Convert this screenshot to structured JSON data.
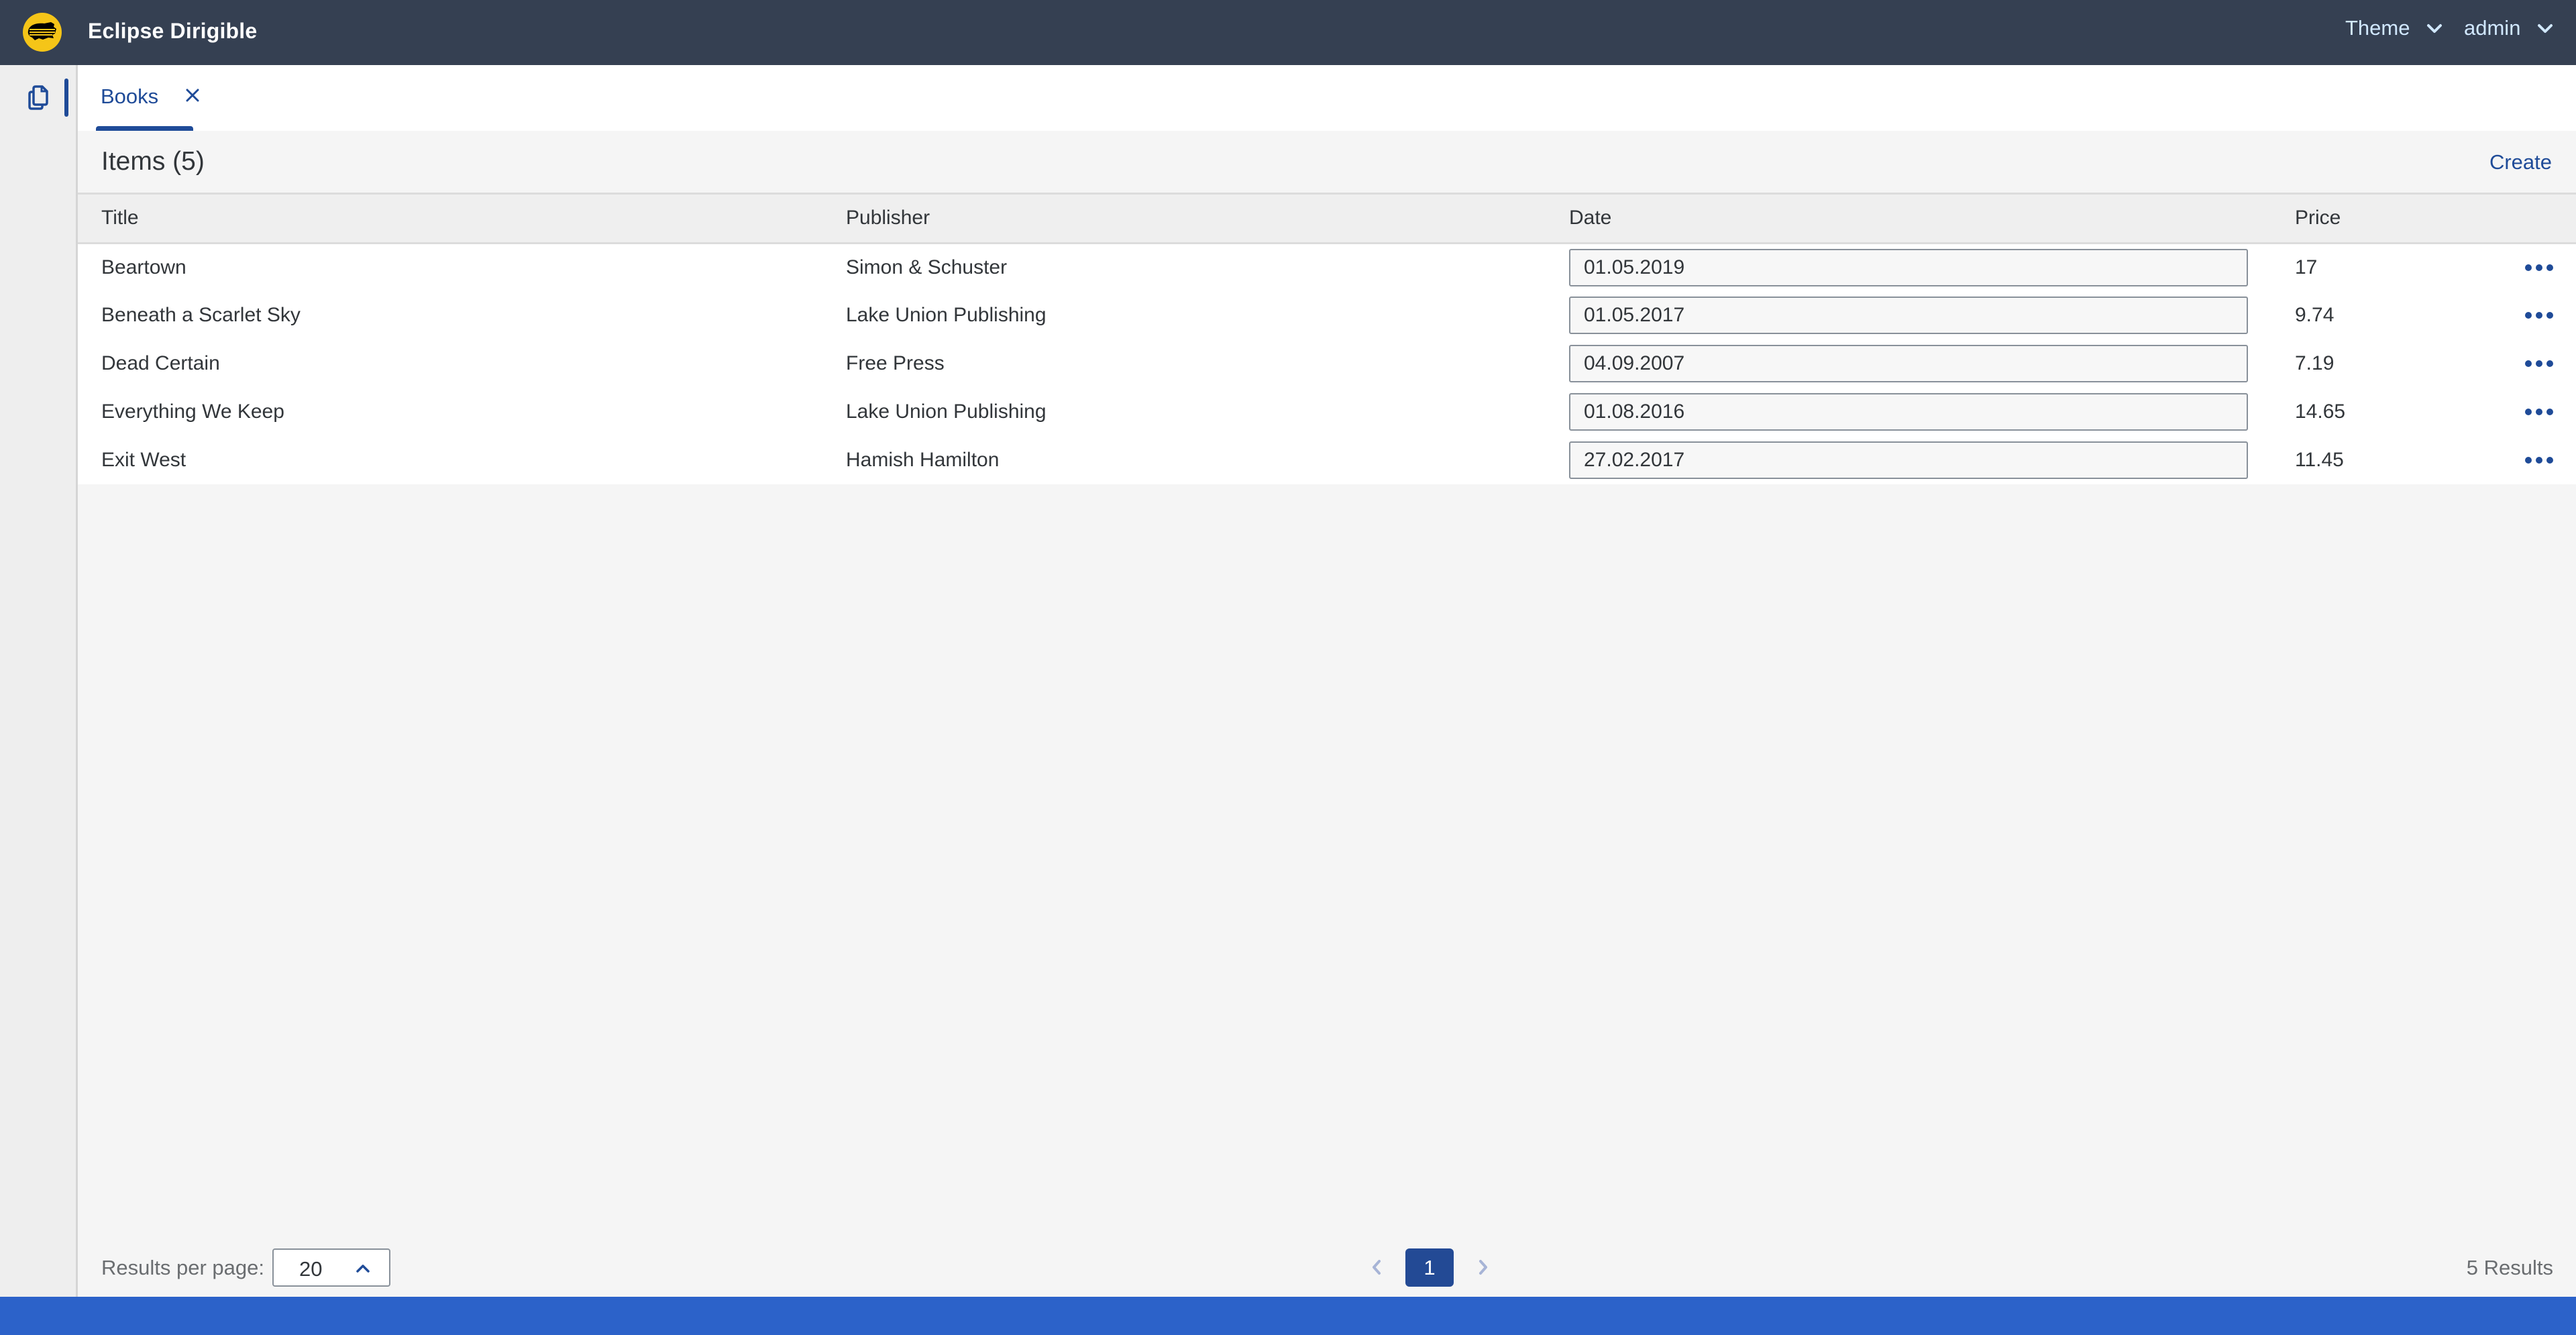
{
  "shell": {
    "product_name": "Eclipse Dirigible",
    "logo_icon": "dirigible-logo-icon",
    "theme_menu_label": "Theme",
    "user_menu_label": "admin",
    "colors": {
      "shell_bg": "#354052",
      "accent": "#1f4b98",
      "status_bar": "#2c62c9",
      "logo_yellow": "#f5c518"
    }
  },
  "sidebar": {
    "items": [
      {
        "icon": "copy-documents-icon",
        "active": true
      }
    ]
  },
  "tabs": [
    {
      "label": "Books",
      "active": true,
      "closable": true
    }
  ],
  "toolbar": {
    "title": "Items (5)",
    "create_label": "Create"
  },
  "table": {
    "columns": [
      "Title",
      "Publisher",
      "Date",
      "Price"
    ],
    "rows": [
      {
        "title": "Beartown",
        "publisher": "Simon & Schuster",
        "date": "01.05.2019",
        "price": "17"
      },
      {
        "title": "Beneath a Scarlet Sky",
        "publisher": "Lake Union Publishing",
        "date": "01.05.2017",
        "price": "9.74"
      },
      {
        "title": "Dead Certain",
        "publisher": "Free Press",
        "date": "04.09.2007",
        "price": "7.19"
      },
      {
        "title": "Everything We Keep",
        "publisher": "Lake Union Publishing",
        "date": "01.08.2016",
        "price": "14.65"
      },
      {
        "title": "Exit West",
        "publisher": "Hamish Hamilton",
        "date": "27.02.2017",
        "price": "11.45"
      }
    ],
    "row_action_icon": "more-options-icon"
  },
  "pagination": {
    "results_per_page_label": "Results per page:",
    "results_per_page_value": "20",
    "current_page": "1",
    "results_label": "5 Results"
  }
}
